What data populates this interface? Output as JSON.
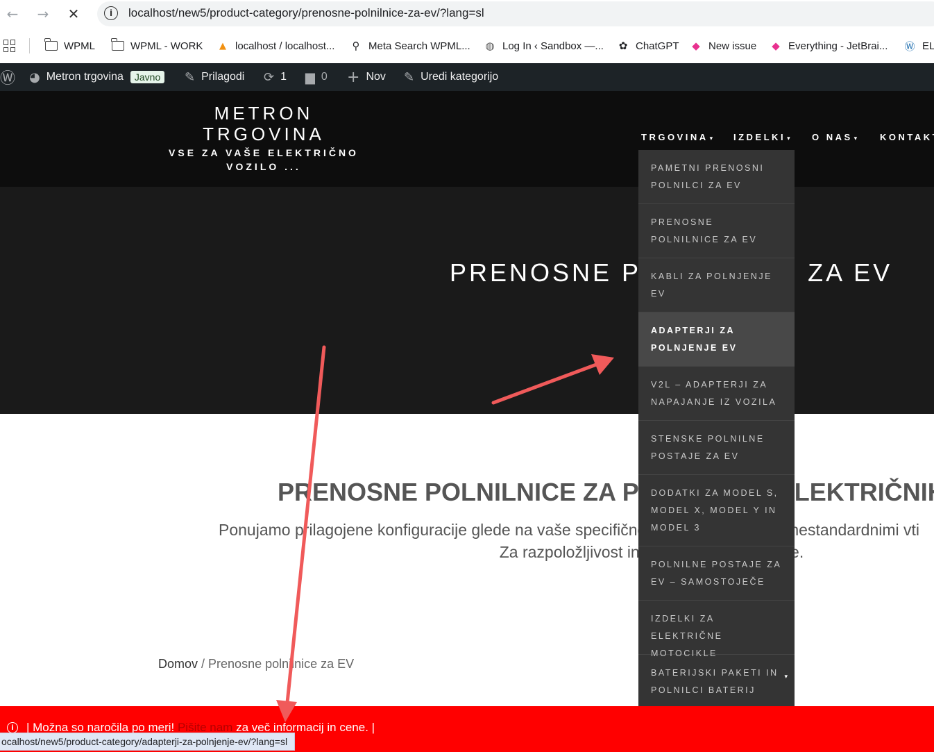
{
  "browser": {
    "url": "localhost/new5/product-category/prenosne-polnilnice-za-ev/?lang=sl",
    "back_glyph": "←",
    "forward_glyph": "→",
    "stop_glyph": "✕",
    "info_glyph": "i",
    "status_url": "ocalhost/new5/product-category/adapterji-za-polnjenje-ev/?lang=sl"
  },
  "bookmarks": [
    {
      "label": "WPML",
      "icon": "folder-icon"
    },
    {
      "label": "WPML - WORK",
      "icon": "folder-icon"
    },
    {
      "label": "localhost / localhost...",
      "icon": "phpmyadmin-icon"
    },
    {
      "label": "Meta Search WPML...",
      "icon": "search-icon"
    },
    {
      "label": "Log In ‹ Sandbox —...",
      "icon": "globe-icon"
    },
    {
      "label": "ChatGPT",
      "icon": "chatgpt-icon"
    },
    {
      "label": "New issue",
      "icon": "jetbrains-icon"
    },
    {
      "label": "Everything - JetBrai...",
      "icon": "jetbrains-icon"
    },
    {
      "label": "ELI",
      "icon": "wordpress-icon"
    }
  ],
  "adminbar": {
    "site_name": "Metron trgovina",
    "badge": "Javno",
    "customize": "Prilagodi",
    "updates": "1",
    "comments": "0",
    "new": "Nov",
    "edit": "Uredi kategorijo"
  },
  "header": {
    "title_line1": "METRON",
    "title_line2": "TRGOVINA",
    "tagline_line1": "VSE ZA VAŠE ELEKTRIČNO",
    "tagline_line2": "VOZILO ...",
    "menu": [
      {
        "label": "TRGOVINA",
        "caret": "▾"
      },
      {
        "label": "IZDELKI",
        "caret": "▾"
      },
      {
        "label": "O NAS",
        "caret": "▾"
      },
      {
        "label": "KONTAKT",
        "caret": ""
      }
    ]
  },
  "dropdown": [
    {
      "label": "PAMETNI PRENOSNI POLNILCI ZA EV"
    },
    {
      "label": "PRENOSNE POLNILNICE ZA EV"
    },
    {
      "label": "KABLI ZA POLNJENJE EV"
    },
    {
      "label": "ADAPTERJI ZA POLNJENJE EV",
      "active": true
    },
    {
      "label": "V2L – ADAPTERJI ZA NAPAJANJE IZ VOZILA"
    },
    {
      "label": "STENSKE POLNILNE POSTAJE ZA EV"
    },
    {
      "label": "DODATKI ZA MODEL S, MODEL X, MODEL Y IN MODEL 3"
    },
    {
      "label": "POLNILNE POSTAJE ZA EV – SAMOSTOJEČE"
    },
    {
      "label": "IZDELKI ZA ELEKTRIČNE MOTOCIKLE"
    },
    {
      "label": "BATERIJSKI PAKETI IN POLNILCI BATERIJ",
      "submenu": "▾"
    }
  ],
  "hero": {
    "title": "PRENOSNE POLNILNICE ZA EV"
  },
  "content": {
    "title": "PRENOSNE POLNILNICE ZA POLNJENJE ELEKTRIČNIH",
    "desc1": "Ponujamo prilagojene konfiguracije glede na vaše specifične zahteve, vključno z nestandardnimi vti",
    "desc2": "Za razpoložljivost in cene nas kontaktirajte."
  },
  "breadcrumb": {
    "home": "Domov",
    "separator": " / ",
    "current": "Prenosne polnilnice za EV"
  },
  "notice": {
    "prefix": "| Možna so naročila po meri!",
    "link": "Pišite nam",
    "suffix": "za več informacij in cene. |"
  },
  "colors": {
    "annotation_arrow": "#f05a5a",
    "notice_bg": "#ff0000"
  }
}
